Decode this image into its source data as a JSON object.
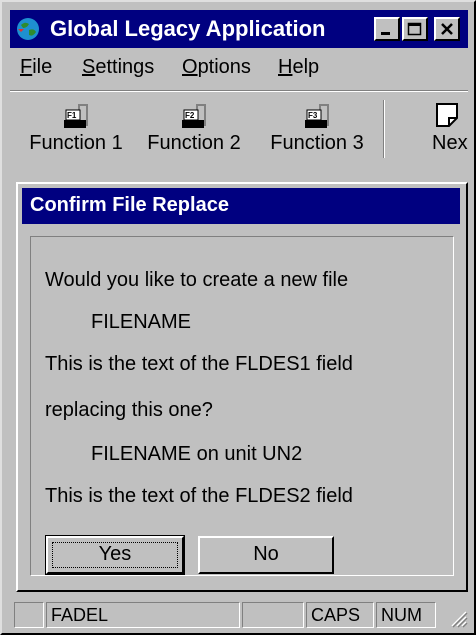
{
  "window": {
    "title": "Global Legacy Application",
    "app_icon": "globe-icon",
    "controls": [
      "minimize-icon",
      "maximize-icon",
      "close-icon"
    ]
  },
  "menu": {
    "items": [
      {
        "label": "File"
      },
      {
        "label": "Settings"
      },
      {
        "label": "Options"
      },
      {
        "label": "Help"
      }
    ]
  },
  "toolbar": {
    "buttons": [
      {
        "label": "Function 1",
        "icon": "f1-key-icon",
        "key": "F1"
      },
      {
        "label": "Function 2",
        "icon": "f2-key-icon",
        "key": "F2"
      },
      {
        "label": "Function 3",
        "icon": "f3-key-icon",
        "key": "F3"
      },
      {
        "label": "Next",
        "icon": "page-icon"
      }
    ]
  },
  "dialog": {
    "title": "Confirm File Replace",
    "lines": [
      "Would you like to create a new file",
      "FILENAME",
      "This is the text of the FLDES1 field",
      "replacing this one?",
      "FILENAME on unit UN2",
      "This is the text of the FLDES2 field"
    ],
    "yes_label": "Yes",
    "no_label": "No"
  },
  "statusbar": {
    "panels": [
      "",
      "FADEL",
      "",
      "CAPS",
      "NUM"
    ]
  },
  "colors": {
    "titlebar": "#000080",
    "face": "#c0c0c0"
  }
}
